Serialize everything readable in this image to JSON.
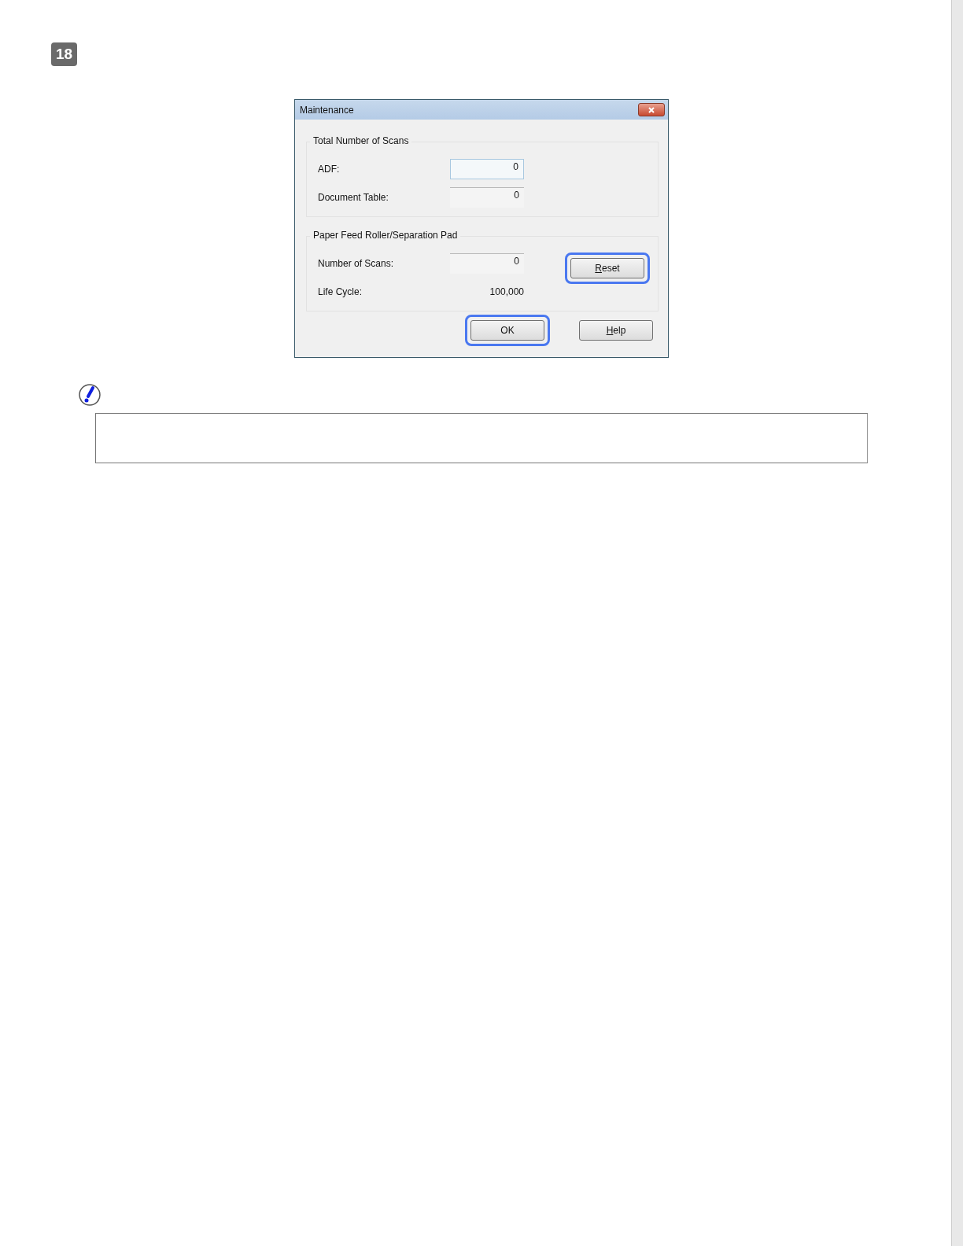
{
  "step": "18",
  "dialog": {
    "title": "Maintenance",
    "groups": [
      {
        "label": "Total Number of Scans",
        "rows": [
          {
            "kind": "field",
            "label": "ADF:",
            "value": "0",
            "focused": true
          },
          {
            "kind": "field",
            "label": "Document Table:",
            "value": "0",
            "focused": false
          }
        ]
      },
      {
        "label": "Paper Feed Roller/Separation Pad",
        "rows": [
          {
            "kind": "field",
            "label": "Number of Scans:",
            "value": "0",
            "focused": false
          },
          {
            "kind": "text",
            "label": "Life Cycle:",
            "value": "100,000"
          }
        ],
        "button": {
          "label": "Reset",
          "mnemonic": true,
          "highlighted": true
        }
      }
    ],
    "buttons": [
      {
        "label": "OK",
        "mnemonic": false,
        "highlighted": true
      },
      {
        "label": "Help",
        "mnemonic": true,
        "highlighted": false
      }
    ]
  }
}
